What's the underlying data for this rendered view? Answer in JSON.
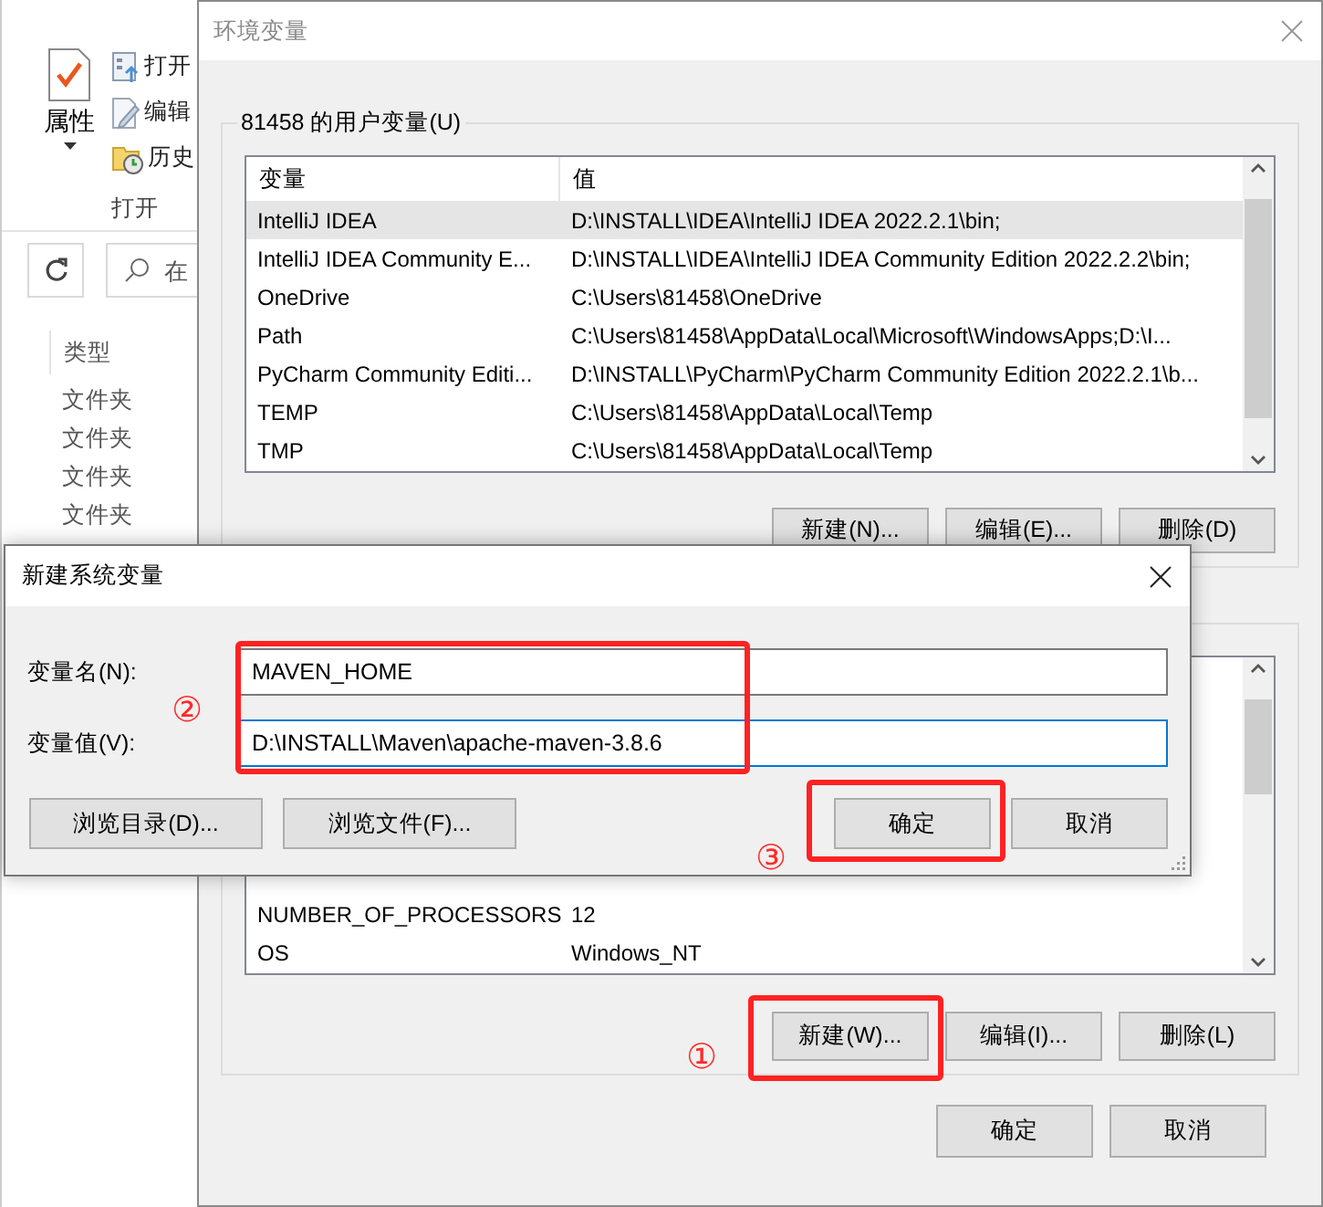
{
  "explorer": {
    "ribbon_button": "属性",
    "ribbon_items": [
      {
        "kind": "open",
        "label": "打开"
      },
      {
        "kind": "edit",
        "label": "编辑"
      },
      {
        "kind": "history",
        "label": "历史"
      }
    ],
    "group_label": "打开",
    "search": {
      "placeholder": "在"
    },
    "column_header": "类型",
    "rows": [
      "文件夹",
      "文件夹",
      "文件夹",
      "文件夹"
    ]
  },
  "env_dialog": {
    "title": "环境变量",
    "user_variables": {
      "label": "81458 的用户变量(U)",
      "columns": [
        "变量",
        "值"
      ],
      "rows": [
        {
          "name": "IntelliJ IDEA",
          "value": "D:\\INSTALL\\IDEA\\IntelliJ IDEA 2022.2.1\\bin;",
          "selected": true
        },
        {
          "name": "IntelliJ IDEA Community E...",
          "value": "D:\\INSTALL\\IDEA\\IntelliJ IDEA Community Edition 2022.2.2\\bin;",
          "selected": false
        },
        {
          "name": "OneDrive",
          "value": "C:\\Users\\81458\\OneDrive",
          "selected": false
        },
        {
          "name": "Path",
          "value": "C:\\Users\\81458\\AppData\\Local\\Microsoft\\WindowsApps;D:\\I...",
          "selected": false
        },
        {
          "name": "PyCharm Community Editi...",
          "value": "D:\\INSTALL\\PyCharm\\PyCharm Community Edition 2022.2.1\\b...",
          "selected": false
        },
        {
          "name": "TEMP",
          "value": "C:\\Users\\81458\\AppData\\Local\\Temp",
          "selected": false
        },
        {
          "name": "TMP",
          "value": "C:\\Users\\81458\\AppData\\Local\\Temp",
          "selected": false
        }
      ],
      "buttons": [
        "新建(N)...",
        "编辑(E)...",
        "删除(D)"
      ]
    },
    "system_variables": {
      "rows": [
        {
          "name": "NUMBER_OF_PROCESSORS",
          "value": "12",
          "selected": false
        },
        {
          "name": "OS",
          "value": "Windows_NT",
          "selected": false
        }
      ],
      "buttons": [
        "新建(W)...",
        "编辑(I)...",
        "删除(L)"
      ]
    },
    "buttons": [
      "确定",
      "取消"
    ]
  },
  "new_variable_dialog": {
    "title": "新建系统变量",
    "fields": [
      {
        "label": "变量名(N):",
        "value": "MAVEN_HOME",
        "focused": false
      },
      {
        "label": "变量值(V):",
        "value": "D:\\INSTALL\\Maven\\apache-maven-3.8.6",
        "focused": true
      }
    ],
    "browse_buttons": [
      "浏览目录(D)...",
      "浏览文件(F)..."
    ],
    "buttons": [
      "确定",
      "取消"
    ]
  },
  "annotations": [
    {
      "marker": "①"
    },
    {
      "marker": "②"
    },
    {
      "marker": "③"
    }
  ]
}
